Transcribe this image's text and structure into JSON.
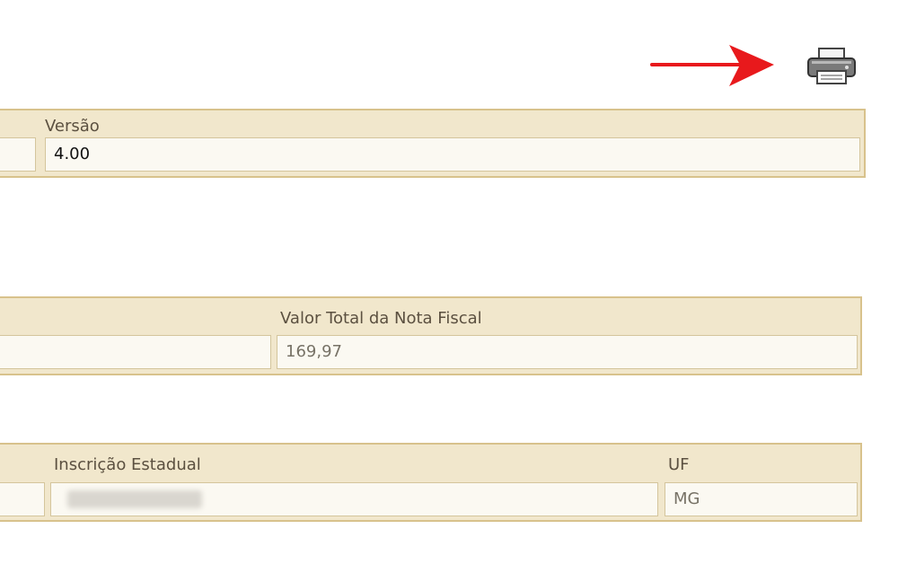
{
  "toolbar": {
    "arrow_color": "#e8191c",
    "print_icon": "printer-icon"
  },
  "sections": {
    "version": {
      "label": "Versão",
      "value": "4.00"
    },
    "totals": {
      "label": "Valor Total da Nota Fiscal",
      "value": "169,97"
    },
    "emitter": {
      "ie_label": "Inscrição Estadual",
      "uf_label": "UF",
      "uf_value": "MG"
    }
  },
  "colors": {
    "section_bg": "#f1e7cc",
    "section_border": "#d8c28c",
    "field_bg": "#fbf9f2"
  }
}
